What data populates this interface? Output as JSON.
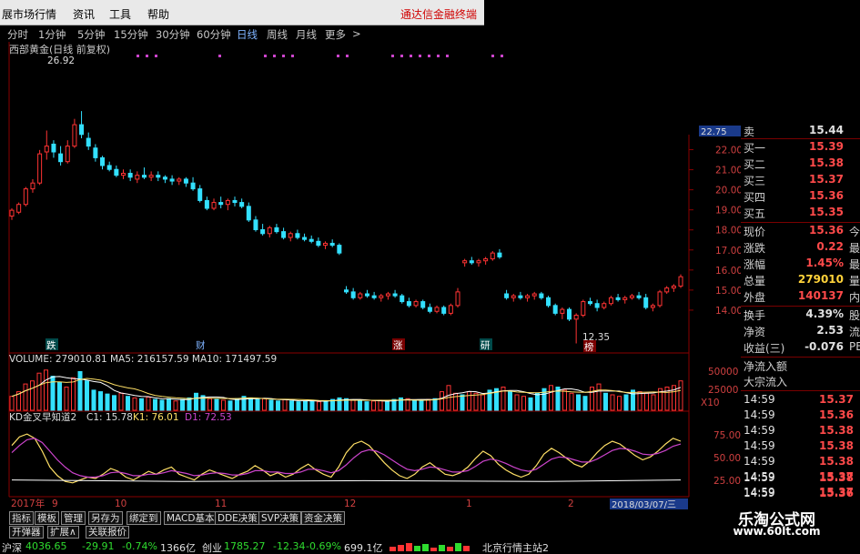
{
  "menu": {
    "items": [
      "展市场行情",
      "资讯",
      "工具",
      "帮助"
    ],
    "promo": "通达信金融终端"
  },
  "periods": [
    "分时",
    "1分钟",
    "5分钟",
    "15分钟",
    "30分钟",
    "60分钟",
    "日线",
    "周线",
    "月线",
    "更多",
    ">"
  ],
  "active_period": "日线",
  "stock": {
    "title": "西部黄金(日线 前复权)",
    "high_label": "26.92",
    "low_label": "12.35"
  },
  "price_axis": [
    "22.00",
    "21.00",
    "20.00",
    "19.00",
    "18.00",
    "17.00",
    "16.00",
    "15.00",
    "14.00"
  ],
  "price_axis_top": "22.75",
  "markers": [
    "跌",
    "财",
    "涨",
    "研",
    "榜"
  ],
  "volume": {
    "header": "VOLUME: 279010.81  MA5: 216157.59  MA10: 171497.59",
    "axis": [
      "50000",
      "25000"
    ],
    "unit": "X10"
  },
  "indicator": {
    "header_label": "KD金叉早知道2",
    "c1": "C1: 15.78",
    "k1": "K1: 76.01",
    "d1": "D1: 72.53",
    "axis": [
      "75.00",
      "50.00",
      "25.00"
    ]
  },
  "date_axis": {
    "labels": [
      "2017年",
      "9",
      "10",
      "11",
      "12",
      "1",
      "2"
    ],
    "current": "2018/03/07/三"
  },
  "colors": {
    "up": "#ff3333",
    "down": "#33e0ff",
    "ma": "#ffffff",
    "k": "#ffe066",
    "d": "#cc44cc"
  },
  "chart_data": [
    {
      "type": "candlestick",
      "title": "西部黄金(日线 前复权)",
      "ylim": [
        12.0,
        22.75
      ],
      "annotations": [
        "26.92",
        "12.35"
      ],
      "candles": [
        {
          "o": 18.9,
          "h": 19.3,
          "l": 18.7,
          "c": 19.2
        },
        {
          "o": 19.1,
          "h": 19.6,
          "l": 19.0,
          "c": 19.5
        },
        {
          "o": 19.5,
          "h": 20.4,
          "l": 19.4,
          "c": 20.3
        },
        {
          "o": 20.3,
          "h": 20.8,
          "l": 20.1,
          "c": 20.6
        },
        {
          "o": 20.6,
          "h": 22.3,
          "l": 20.5,
          "c": 22.1
        },
        {
          "o": 22.2,
          "h": 23.3,
          "l": 21.8,
          "c": 22.5
        },
        {
          "o": 22.6,
          "h": 22.8,
          "l": 21.9,
          "c": 22.2
        },
        {
          "o": 22.1,
          "h": 22.5,
          "l": 21.5,
          "c": 21.7
        },
        {
          "o": 21.7,
          "h": 22.8,
          "l": 21.6,
          "c": 22.5
        },
        {
          "o": 22.5,
          "h": 23.9,
          "l": 22.4,
          "c": 23.6
        },
        {
          "o": 23.6,
          "h": 24.3,
          "l": 22.9,
          "c": 23.1
        },
        {
          "o": 22.9,
          "h": 23.2,
          "l": 22.3,
          "c": 22.5
        },
        {
          "o": 22.4,
          "h": 22.6,
          "l": 21.7,
          "c": 21.9
        },
        {
          "o": 21.9,
          "h": 22.0,
          "l": 21.3,
          "c": 21.5
        },
        {
          "o": 21.5,
          "h": 21.7,
          "l": 21.2,
          "c": 21.3
        },
        {
          "o": 21.3,
          "h": 21.5,
          "l": 20.9,
          "c": 21.0
        },
        {
          "o": 21.0,
          "h": 21.3,
          "l": 20.8,
          "c": 21.1
        },
        {
          "o": 21.1,
          "h": 21.3,
          "l": 20.7,
          "c": 20.9
        },
        {
          "o": 20.8,
          "h": 21.2,
          "l": 20.6,
          "c": 21.0
        },
        {
          "o": 21.0,
          "h": 21.4,
          "l": 20.8,
          "c": 20.9
        },
        {
          "o": 20.9,
          "h": 21.2,
          "l": 20.7,
          "c": 21.0
        },
        {
          "o": 21.0,
          "h": 21.2,
          "l": 20.7,
          "c": 20.9
        },
        {
          "o": 20.9,
          "h": 21.0,
          "l": 20.6,
          "c": 20.8
        },
        {
          "o": 20.8,
          "h": 21.0,
          "l": 20.5,
          "c": 20.7
        },
        {
          "o": 20.7,
          "h": 20.9,
          "l": 20.5,
          "c": 20.8
        },
        {
          "o": 20.8,
          "h": 20.9,
          "l": 20.4,
          "c": 20.6
        },
        {
          "o": 20.6,
          "h": 20.9,
          "l": 20.2,
          "c": 20.3
        },
        {
          "o": 20.3,
          "h": 20.5,
          "l": 19.6,
          "c": 19.7
        },
        {
          "o": 19.7,
          "h": 19.9,
          "l": 19.2,
          "c": 19.3
        },
        {
          "o": 19.3,
          "h": 19.8,
          "l": 19.2,
          "c": 19.6
        },
        {
          "o": 19.6,
          "h": 19.9,
          "l": 19.3,
          "c": 19.5
        },
        {
          "o": 19.5,
          "h": 19.8,
          "l": 19.2,
          "c": 19.7
        },
        {
          "o": 19.7,
          "h": 19.9,
          "l": 19.4,
          "c": 19.6
        },
        {
          "o": 19.6,
          "h": 19.8,
          "l": 19.3,
          "c": 19.4
        },
        {
          "o": 19.4,
          "h": 19.6,
          "l": 18.6,
          "c": 18.7
        },
        {
          "o": 18.7,
          "h": 18.9,
          "l": 18.1,
          "c": 18.2
        },
        {
          "o": 18.2,
          "h": 18.5,
          "l": 17.9,
          "c": 18.0
        },
        {
          "o": 18.0,
          "h": 18.4,
          "l": 17.8,
          "c": 18.3
        },
        {
          "o": 18.3,
          "h": 18.5,
          "l": 18.0,
          "c": 18.1
        },
        {
          "o": 18.1,
          "h": 18.3,
          "l": 17.7,
          "c": 17.8
        },
        {
          "o": 17.8,
          "h": 18.1,
          "l": 17.6,
          "c": 18.0
        },
        {
          "o": 18.0,
          "h": 18.2,
          "l": 17.7,
          "c": 17.8
        },
        {
          "o": 17.8,
          "h": 18.0,
          "l": 17.6,
          "c": 17.7
        },
        {
          "o": 17.7,
          "h": 17.9,
          "l": 17.5,
          "c": 17.6
        },
        {
          "o": 17.6,
          "h": 17.8,
          "l": 17.3,
          "c": 17.4
        },
        {
          "o": 17.4,
          "h": 17.6,
          "l": 17.2,
          "c": 17.5
        },
        {
          "o": 17.5,
          "h": 17.7,
          "l": 17.3,
          "c": 17.4
        },
        {
          "o": 17.4,
          "h": 17.5,
          "l": 16.9,
          "c": 17.0
        },
        {
          "o": 15.1,
          "h": 15.3,
          "l": 14.9,
          "c": 15.0
        },
        {
          "o": 15.0,
          "h": 15.2,
          "l": 14.6,
          "c": 14.7
        },
        {
          "o": 14.7,
          "h": 15.0,
          "l": 14.6,
          "c": 14.9
        },
        {
          "o": 14.9,
          "h": 15.1,
          "l": 14.7,
          "c": 14.8
        },
        {
          "o": 14.8,
          "h": 15.0,
          "l": 14.6,
          "c": 14.7
        },
        {
          "o": 14.7,
          "h": 14.9,
          "l": 14.5,
          "c": 14.8
        },
        {
          "o": 14.8,
          "h": 15.0,
          "l": 14.6,
          "c": 14.9
        },
        {
          "o": 14.9,
          "h": 15.1,
          "l": 14.7,
          "c": 14.8
        },
        {
          "o": 14.8,
          "h": 14.9,
          "l": 14.4,
          "c": 14.5
        },
        {
          "o": 14.5,
          "h": 14.7,
          "l": 14.2,
          "c": 14.3
        },
        {
          "o": 14.3,
          "h": 14.6,
          "l": 14.2,
          "c": 14.5
        },
        {
          "o": 14.5,
          "h": 14.6,
          "l": 14.1,
          "c": 14.2
        },
        {
          "o": 14.2,
          "h": 14.4,
          "l": 13.9,
          "c": 14.0
        },
        {
          "o": 14.0,
          "h": 14.3,
          "l": 13.9,
          "c": 14.2
        },
        {
          "o": 14.2,
          "h": 14.3,
          "l": 13.8,
          "c": 13.9
        },
        {
          "o": 13.9,
          "h": 14.4,
          "l": 13.8,
          "c": 14.3
        },
        {
          "o": 14.3,
          "h": 15.2,
          "l": 14.2,
          "c": 15.0
        },
        {
          "o": 16.5,
          "h": 16.7,
          "l": 16.3,
          "c": 16.6
        },
        {
          "o": 16.6,
          "h": 16.8,
          "l": 16.4,
          "c": 16.5
        },
        {
          "o": 16.5,
          "h": 16.7,
          "l": 16.3,
          "c": 16.6
        },
        {
          "o": 16.6,
          "h": 16.8,
          "l": 16.4,
          "c": 16.7
        },
        {
          "o": 16.7,
          "h": 17.1,
          "l": 16.6,
          "c": 17.0
        },
        {
          "o": 17.0,
          "h": 17.2,
          "l": 16.7,
          "c": 16.8
        },
        {
          "o": 14.9,
          "h": 15.1,
          "l": 14.6,
          "c": 14.7
        },
        {
          "o": 14.7,
          "h": 14.9,
          "l": 14.5,
          "c": 14.8
        },
        {
          "o": 14.8,
          "h": 15.0,
          "l": 14.6,
          "c": 14.7
        },
        {
          "o": 14.7,
          "h": 14.9,
          "l": 14.5,
          "c": 14.8
        },
        {
          "o": 14.8,
          "h": 15.0,
          "l": 14.6,
          "c": 14.9
        },
        {
          "o": 14.9,
          "h": 15.0,
          "l": 14.6,
          "c": 14.7
        },
        {
          "o": 14.7,
          "h": 14.8,
          "l": 14.2,
          "c": 14.3
        },
        {
          "o": 14.3,
          "h": 14.4,
          "l": 13.8,
          "c": 13.9
        },
        {
          "o": 13.9,
          "h": 14.2,
          "l": 13.6,
          "c": 14.1
        },
        {
          "o": 14.1,
          "h": 14.2,
          "l": 13.5,
          "c": 13.6
        },
        {
          "o": 13.6,
          "h": 13.9,
          "l": 12.35,
          "c": 13.8
        },
        {
          "o": 13.8,
          "h": 14.6,
          "l": 13.7,
          "c": 14.5
        },
        {
          "o": 14.5,
          "h": 14.7,
          "l": 14.3,
          "c": 14.4
        },
        {
          "o": 14.4,
          "h": 14.6,
          "l": 14.0,
          "c": 14.2
        },
        {
          "o": 14.2,
          "h": 14.5,
          "l": 14.1,
          "c": 14.4
        },
        {
          "o": 14.4,
          "h": 14.8,
          "l": 14.3,
          "c": 14.7
        },
        {
          "o": 14.7,
          "h": 14.9,
          "l": 14.5,
          "c": 14.6
        },
        {
          "o": 14.6,
          "h": 14.8,
          "l": 14.4,
          "c": 14.7
        },
        {
          "o": 14.7,
          "h": 14.9,
          "l": 14.6,
          "c": 14.8
        },
        {
          "o": 14.8,
          "h": 15.0,
          "l": 14.6,
          "c": 14.7
        },
        {
          "o": 14.7,
          "h": 14.9,
          "l": 14.1,
          "c": 14.2
        },
        {
          "o": 14.2,
          "h": 14.4,
          "l": 14.0,
          "c": 14.3
        },
        {
          "o": 14.3,
          "h": 15.1,
          "l": 14.2,
          "c": 15.0
        },
        {
          "o": 15.0,
          "h": 15.3,
          "l": 14.9,
          "c": 15.2
        },
        {
          "o": 15.2,
          "h": 15.4,
          "l": 15.0,
          "c": 15.3
        },
        {
          "o": 15.3,
          "h": 15.9,
          "l": 15.2,
          "c": 15.78
        }
      ]
    },
    {
      "type": "bar",
      "title": "VOLUME",
      "ylim": [
        0,
        60000
      ],
      "series": [
        {
          "name": "VOLUME",
          "values": [
            18000,
            24000,
            34000,
            38000,
            48000,
            52000,
            44000,
            36000,
            30000,
            42000,
            50000,
            38000,
            26000,
            24000,
            21000,
            19000,
            22000,
            18000,
            16000,
            15000,
            17000,
            14000,
            13000,
            15000,
            12000,
            14000,
            16000,
            22000,
            19000,
            15000,
            14000,
            13000,
            12000,
            15000,
            18000,
            16000,
            14000,
            15000,
            13000,
            12000,
            14000,
            12000,
            11000,
            12000,
            13000,
            11000,
            12000,
            14000,
            16000,
            15000,
            13000,
            12000,
            11000,
            12000,
            13000,
            11000,
            14000,
            16000,
            15000,
            13000,
            12000,
            14000,
            15000,
            24000,
            32000,
            22000,
            20000,
            24000,
            22000,
            20000,
            26000,
            28000,
            30000,
            24000,
            20000,
            18000,
            16000,
            22000,
            28000,
            32000,
            30000,
            26000,
            22000,
            20000,
            18000,
            30000,
            34000,
            22000,
            20000,
            18000,
            20000,
            26000,
            24000,
            22000,
            20000,
            28000,
            30000,
            32000,
            38000
          ]
        }
      ]
    },
    {
      "type": "line",
      "title": "KD金叉早知道2",
      "ylim": [
        0,
        100
      ],
      "series": [
        {
          "name": "K",
          "values": [
            70,
            82,
            86,
            80,
            62,
            40,
            28,
            20,
            18,
            22,
            26,
            24,
            30,
            38,
            34,
            26,
            22,
            28,
            34,
            30,
            36,
            40,
            30,
            26,
            22,
            30,
            36,
            32,
            28,
            24,
            30,
            34,
            42,
            36,
            28,
            32,
            26,
            30,
            38,
            44,
            36,
            30,
            26,
            40,
            60,
            72,
            76,
            70,
            58,
            46,
            36,
            28,
            24,
            30,
            40,
            46,
            38,
            30,
            28,
            32,
            40,
            52,
            62,
            56,
            44,
            36,
            30,
            26,
            30,
            42,
            58,
            66,
            60,
            52,
            44,
            40,
            48,
            60,
            70,
            76,
            72,
            64,
            56,
            50,
            54,
            62,
            72,
            80,
            76
          ]
        },
        {
          "name": "D",
          "values": [
            60,
            70,
            78,
            80,
            74,
            62,
            50,
            40,
            32,
            28,
            26,
            26,
            28,
            32,
            33,
            31,
            28,
            28,
            30,
            30,
            32,
            35,
            33,
            31,
            28,
            29,
            31,
            32,
            31,
            29,
            29,
            31,
            35,
            35,
            33,
            33,
            31,
            31,
            33,
            37,
            37,
            35,
            32,
            35,
            43,
            53,
            61,
            64,
            62,
            57,
            50,
            43,
            37,
            35,
            37,
            40,
            39,
            36,
            33,
            33,
            35,
            41,
            48,
            51,
            49,
            45,
            40,
            36,
            34,
            37,
            44,
            51,
            54,
            53,
            50,
            47,
            47,
            51,
            57,
            63,
            66,
            65,
            62,
            58,
            57,
            59,
            63,
            69,
            72
          ]
        }
      ]
    }
  ],
  "quote": {
    "top_cut": "15.44",
    "asks": [
      {
        "label": "买一",
        "value": "15.39"
      },
      {
        "label": "买二",
        "value": "15.38"
      },
      {
        "label": "买三",
        "value": "15.37"
      },
      {
        "label": "买四",
        "value": "15.36"
      },
      {
        "label": "买五",
        "value": "15.35"
      }
    ],
    "stats": [
      {
        "label": "现价",
        "value": "15.36",
        "ext": "今"
      },
      {
        "label": "涨跌",
        "value": "0.22",
        "ext": "最"
      },
      {
        "label": "涨幅",
        "value": "1.45%",
        "ext": "最"
      },
      {
        "label": "总量",
        "value": "279010",
        "ext": "量"
      },
      {
        "label": "外盘",
        "value": "140137",
        "ext": "内"
      }
    ],
    "stats2": [
      {
        "label": "换手",
        "value": "4.39%",
        "ext": "股"
      },
      {
        "label": "净资",
        "value": "2.53",
        "ext": "流"
      },
      {
        "label": "收益(三)",
        "value": "-0.076",
        "ext": "PE"
      }
    ],
    "flows": [
      "净流入额",
      "大宗流入"
    ],
    "ticks": [
      {
        "time": "14:59",
        "price": "15.37"
      },
      {
        "time": "14:59",
        "price": "15.36"
      },
      {
        "time": "14:59",
        "price": "15.38"
      },
      {
        "time": "14:59",
        "price": "15.38"
      },
      {
        "time": "14:59",
        "price": "15.38"
      },
      {
        "time": "14:59",
        "price": "15.37"
      },
      {
        "time": "14:59",
        "price": "15.37"
      },
      {
        "time": "14:59",
        "price": "15.38"
      },
      {
        "time": "14:59",
        "price": "15.36"
      },
      {
        "time": "14:59",
        "price": "15.36"
      }
    ]
  },
  "bottom_tabs": [
    "指标",
    "模板",
    "管理",
    "另存为",
    "绑定到",
    "MACD基本",
    "DDE决策",
    "SVP决策",
    "资金决策"
  ],
  "bottom_tabs2": [
    "开弹器",
    "扩展∧",
    "关联报价"
  ],
  "status": {
    "sh_label": "沪深",
    "sh_value": "4036.65",
    "sh_change": "-29.91",
    "sh_pct": "-0.74%",
    "sh_amount": "1366亿",
    "cy_label": "创业",
    "cy_value": "1785.27",
    "cy_change": "-12.34",
    "cy_pct": "-0.69%",
    "cy_amount": "699.1亿",
    "server": "北京行情主站2"
  },
  "watermark": {
    "title": "乐淘公式网",
    "url": "www.60lt.com"
  }
}
